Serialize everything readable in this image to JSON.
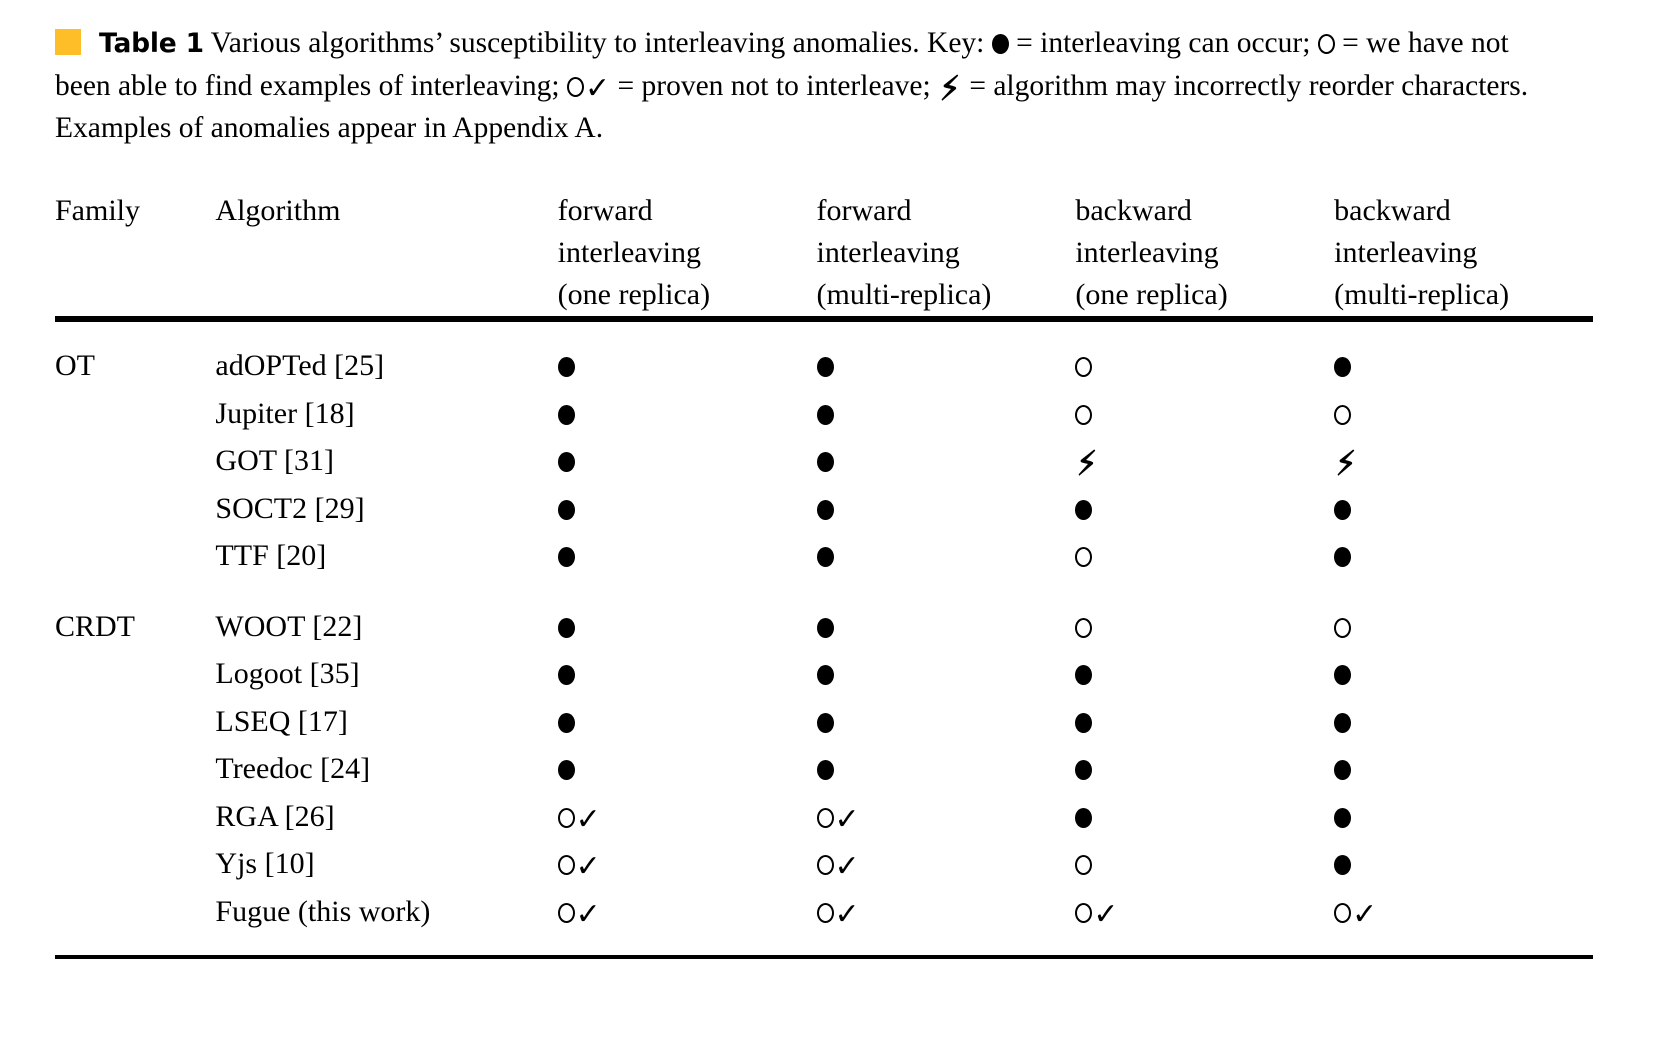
{
  "caption": {
    "marker_color": "#FDBE28",
    "label": "Table 1",
    "part1": " Various algorithms’ susceptibility to interleaving anomalies. Key: ",
    "part2": " = interleaving can occur; ",
    "part3": " = we have not been able to find examples of interleaving; ",
    "part4": " = proven not to interleave; ",
    "part5": " = algorithm may incorrectly reorder characters. Examples of anomalies appear in Appendix A.",
    "key": {
      "filled_symbol": "filled-circle",
      "filled_meaning": "interleaving can occur",
      "open_symbol": "open-circle",
      "open_meaning": "we have not been able to find examples of interleaving",
      "open_check_symbol": "open-circle-check",
      "open_check_meaning": "proven not to interleave",
      "bolt_symbol": "lightning-bolt",
      "bolt_meaning": "algorithm may incorrectly reorder characters"
    }
  },
  "table": {
    "headers": {
      "family": [
        "Family"
      ],
      "algorithm": [
        "Algorithm"
      ],
      "col1": [
        "forward",
        "interleaving",
        "(one replica)"
      ],
      "col2": [
        "forward",
        "interleaving",
        "(multi-replica)"
      ],
      "col3": [
        "backward",
        "interleaving",
        "(one replica)"
      ],
      "col4": [
        "backward",
        "interleaving",
        "(multi-replica)"
      ]
    },
    "groups": [
      {
        "family": "OT",
        "rows": [
          {
            "algorithm": "adOPTed [25]",
            "values": [
              "filled",
              "filled",
              "open",
              "filled"
            ]
          },
          {
            "algorithm": "Jupiter [18]",
            "values": [
              "filled",
              "filled",
              "open",
              "open"
            ]
          },
          {
            "algorithm": "GOT [31]",
            "values": [
              "filled",
              "filled",
              "bolt",
              "bolt"
            ]
          },
          {
            "algorithm": "SOCT2 [29]",
            "values": [
              "filled",
              "filled",
              "filled",
              "filled"
            ]
          },
          {
            "algorithm": "TTF [20]",
            "values": [
              "filled",
              "filled",
              "open",
              "filled"
            ]
          }
        ]
      },
      {
        "family": "CRDT",
        "rows": [
          {
            "algorithm": "WOOT [22]",
            "values": [
              "filled",
              "filled",
              "open",
              "open"
            ]
          },
          {
            "algorithm": "Logoot [35]",
            "values": [
              "filled",
              "filled",
              "filled",
              "filled"
            ]
          },
          {
            "algorithm": "LSEQ [17]",
            "values": [
              "filled",
              "filled",
              "filled",
              "filled"
            ]
          },
          {
            "algorithm": "Treedoc [24]",
            "values": [
              "filled",
              "filled",
              "filled",
              "filled"
            ]
          },
          {
            "algorithm": "RGA [26]",
            "values": [
              "opencheck",
              "opencheck",
              "filled",
              "filled"
            ]
          },
          {
            "algorithm": "Yjs [10]",
            "values": [
              "opencheck",
              "opencheck",
              "open",
              "filled"
            ]
          },
          {
            "algorithm": "Fugue (this work)",
            "values": [
              "opencheck",
              "opencheck",
              "opencheck",
              "opencheck"
            ]
          }
        ]
      }
    ]
  }
}
